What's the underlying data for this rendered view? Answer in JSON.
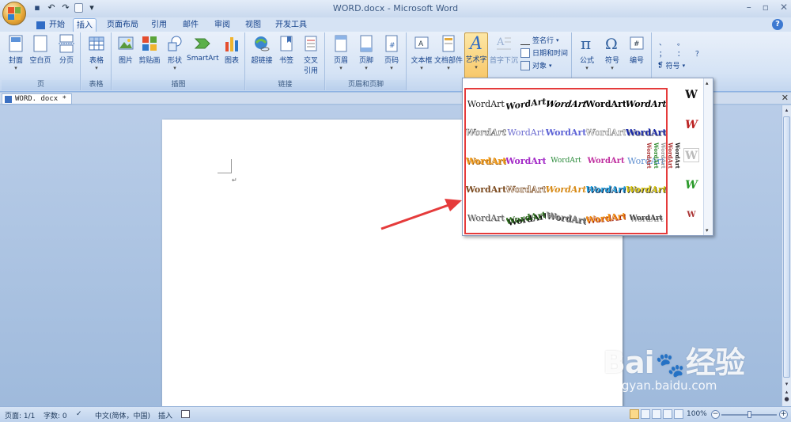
{
  "window": {
    "title": "WORD.docx - Microsoft Word"
  },
  "quick_access": {
    "undo_symbol": "↶",
    "redo_symbol": "↷",
    "save_symbol": "▪",
    "customize_symbol": "▾"
  },
  "window_controls": {
    "minimize": "–",
    "restore": "▫",
    "close": "✕"
  },
  "tabs": [
    {
      "label": "开始"
    },
    {
      "label": "插入"
    },
    {
      "label": "页面布局"
    },
    {
      "label": "引用"
    },
    {
      "label": "邮件"
    },
    {
      "label": "审阅"
    },
    {
      "label": "视图"
    },
    {
      "label": "开发工具"
    }
  ],
  "ribbon": {
    "groups": {
      "pages": {
        "name": "页",
        "buttons": [
          "封面",
          "空白页",
          "分页"
        ]
      },
      "tables": {
        "name": "表格",
        "buttons": [
          "表格"
        ]
      },
      "illustrations": {
        "name": "插图",
        "buttons": [
          "图片",
          "剪贴画",
          "形状",
          "SmartArt",
          "图表"
        ]
      },
      "links": {
        "name": "链接",
        "buttons": [
          "超链接",
          "书签",
          "交叉",
          "引用"
        ]
      },
      "header_footer": {
        "name": "页眉和页脚",
        "buttons": [
          "页眉",
          "页脚",
          "页码"
        ]
      },
      "text": {
        "buttons": [
          "文本框",
          "文档部件",
          "艺术字",
          "首字下沉"
        ],
        "small": [
          "签名行",
          "日期和时间",
          "对象"
        ]
      },
      "symbols": {
        "buttons": [
          "公式",
          "符号",
          "编号"
        ],
        "symbol_label": "符号",
        "punct": [
          "、",
          "。",
          "；",
          "：",
          "？"
        ]
      }
    }
  },
  "document": {
    "tab_label": "WORD. docx *",
    "paragraph_mark": "↵"
  },
  "wordart_gallery": {
    "item_text": "WordArt",
    "side_letter": "W"
  },
  "statusbar": {
    "page": "页面: 1/1",
    "words": "字数: 0",
    "language": "中文(简体，中国)",
    "mode": "插入",
    "zoom": "100%"
  },
  "watermark": {
    "brand": "Bai",
    "brand_suffix": "经验",
    "url": "jingyan.baidu.com"
  },
  "colors": {
    "accent_red": "#e53b3b",
    "ribbon_text": "#15428b"
  }
}
